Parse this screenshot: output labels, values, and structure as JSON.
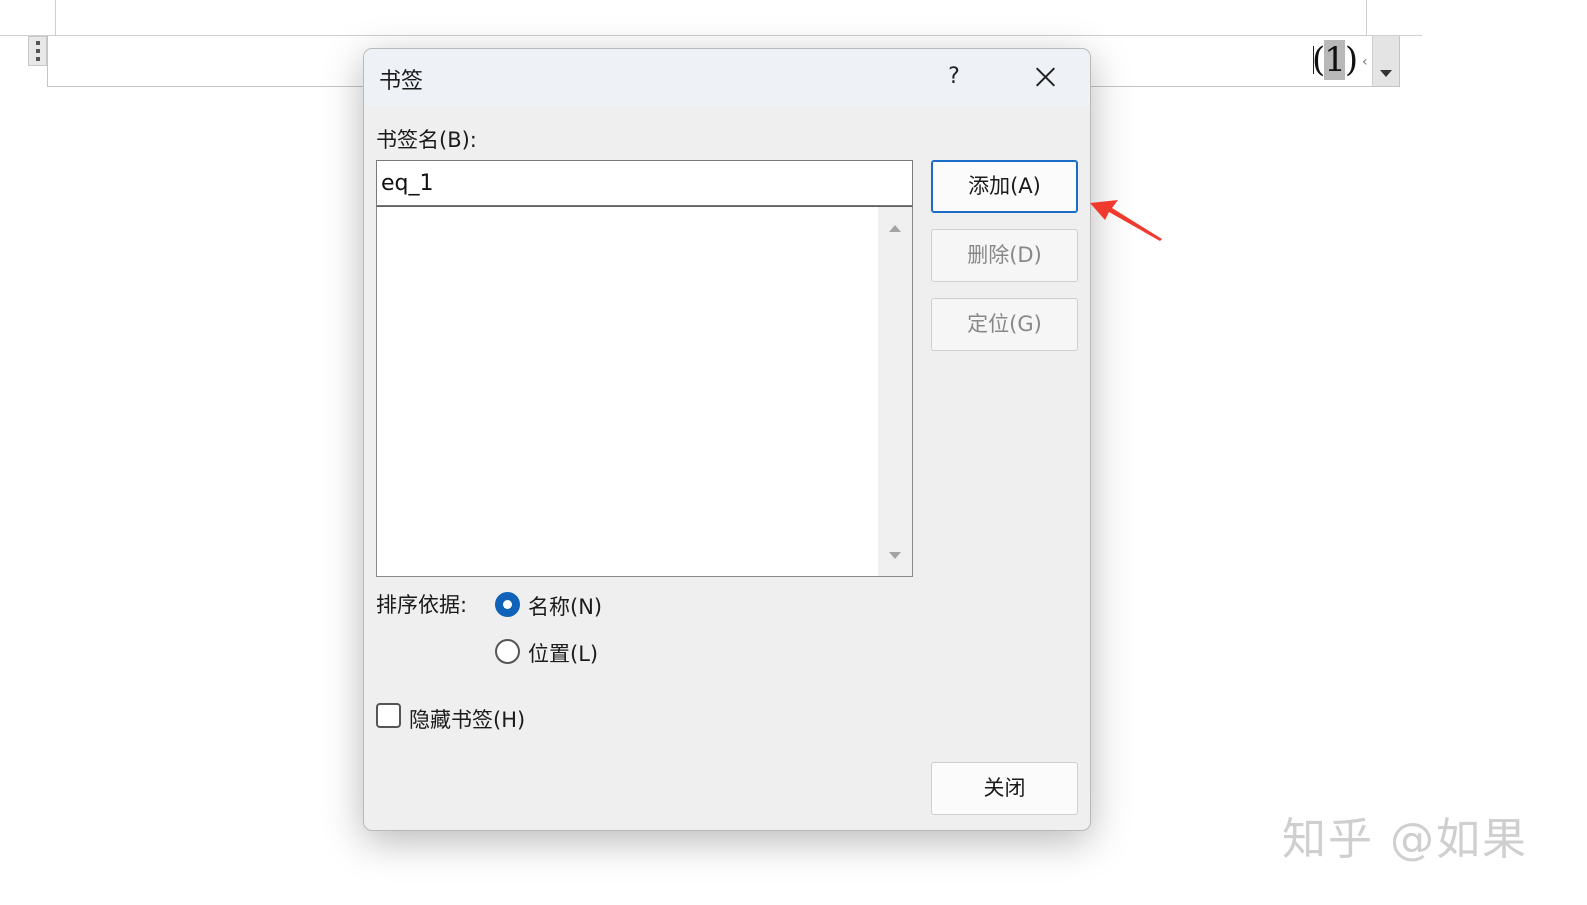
{
  "document": {
    "equation_number": "(1)",
    "equation_digit": "1",
    "cursor_mark": "‹"
  },
  "dialog": {
    "title": "书签",
    "help_label": "?",
    "bookmark_name_label": "书签名(B):",
    "bookmark_name_value": "eq_1",
    "bookmark_list": [],
    "buttons": {
      "add": "添加(A)",
      "delete": "删除(D)",
      "goto": "定位(G)",
      "close": "关闭"
    },
    "sort_by_label": "排序依据:",
    "sort_options": {
      "name": "名称(N)",
      "location": "位置(L)"
    },
    "sort_selected": "名称(N)",
    "hide_bookmarks_label": "隐藏书签(H)",
    "hide_bookmarks_checked": false
  },
  "annotation": {
    "arrow_color": "#f03a2e"
  },
  "watermark": "知乎 @如果",
  "colors": {
    "accent": "#0f62b7",
    "dialog_bg": "#efefef",
    "titlebar_bg": "#eef2f7"
  }
}
